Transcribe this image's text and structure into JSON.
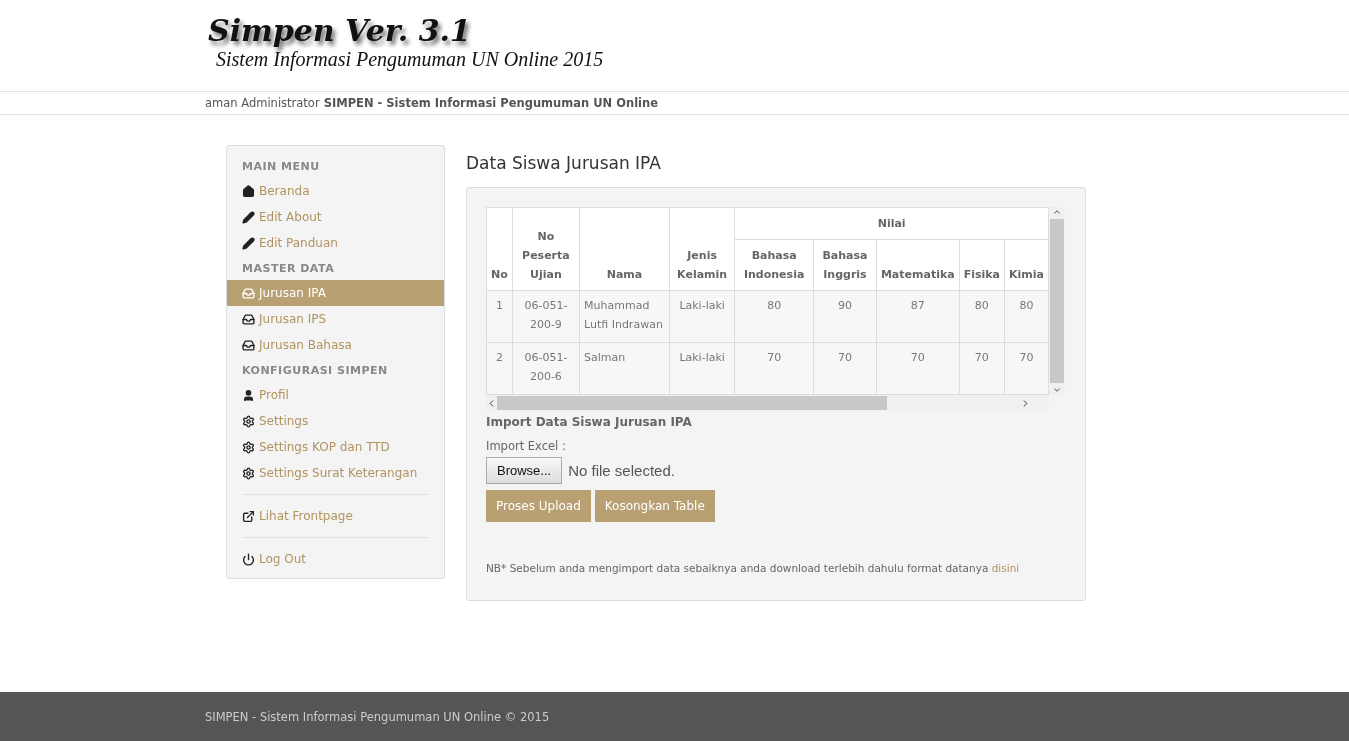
{
  "header": {
    "logo_title": "Simpen Ver. 3.1",
    "logo_subtitle": "Sistem Informasi Pengumuman UN Online 2015"
  },
  "marquee": {
    "text": "aman Administrator",
    "bold": "SIMPEN - Sistem Informasi Pengumuman UN Online"
  },
  "sidebar": {
    "sections": [
      {
        "heading": "MAIN MENU",
        "items": [
          {
            "label": "Beranda",
            "selected": false
          },
          {
            "label": "Edit About",
            "selected": false
          },
          {
            "label": "Edit Panduan",
            "selected": false
          }
        ]
      },
      {
        "heading": "MASTER DATA",
        "items": [
          {
            "label": "Jurusan IPA",
            "selected": true
          },
          {
            "label": "Jurusan IPS",
            "selected": false
          },
          {
            "label": "Jurusan Bahasa",
            "selected": false
          }
        ]
      },
      {
        "heading": "KONFIGURASI SIMPEN",
        "items": [
          {
            "label": "Profil",
            "selected": false
          },
          {
            "label": "Settings",
            "selected": false
          },
          {
            "label": "Settings KOP dan TTD",
            "selected": false
          },
          {
            "label": "Settings Surat Keterangan",
            "selected": false
          }
        ]
      },
      {
        "items": [
          {
            "label": "Lihat Frontpage",
            "selected": false
          }
        ]
      },
      {
        "items": [
          {
            "label": "Log Out",
            "selected": false
          }
        ]
      }
    ]
  },
  "content": {
    "title": "Data Siswa Jurusan IPA",
    "table": {
      "group_header": "Nilai",
      "columns": [
        {
          "label": "No",
          "grouped": false
        },
        {
          "label": "No Peserta Ujian",
          "grouped": false
        },
        {
          "label": "Nama",
          "grouped": false
        },
        {
          "label": "Jenis Kelamin",
          "grouped": false
        },
        {
          "label": "Bahasa Indonesia",
          "grouped": true
        },
        {
          "label": "Bahasa Inggris",
          "grouped": true
        },
        {
          "label": "Matematika",
          "grouped": true
        },
        {
          "label": "Fisika",
          "grouped": true
        },
        {
          "label": "Kimia",
          "grouped": true
        }
      ],
      "rows": [
        [
          "1",
          "06-051-200-9",
          "Muhammad Lutfi Indrawan",
          "Laki-laki",
          "80",
          "90",
          "87",
          "80",
          "80"
        ],
        [
          "2",
          "06-051-200-6",
          "Salman",
          "Laki-laki",
          "70",
          "70",
          "70",
          "70",
          "70"
        ]
      ]
    },
    "import_title": "Import Data Siswa Jurusan IPA",
    "import_label": "Import Excel :",
    "browse_button": "Browse...",
    "file_status": "No file selected.",
    "buttons": [
      "Proses Upload",
      "Kosongkan Table"
    ],
    "note": "NB* Sebelum anda mengimport data sebaiknya anda download terlebih dahulu format datanya",
    "note_link": "disini"
  },
  "footer": {
    "text": "SIMPEN - Sistem Informasi Pengumuman UN Online © 2015"
  }
}
